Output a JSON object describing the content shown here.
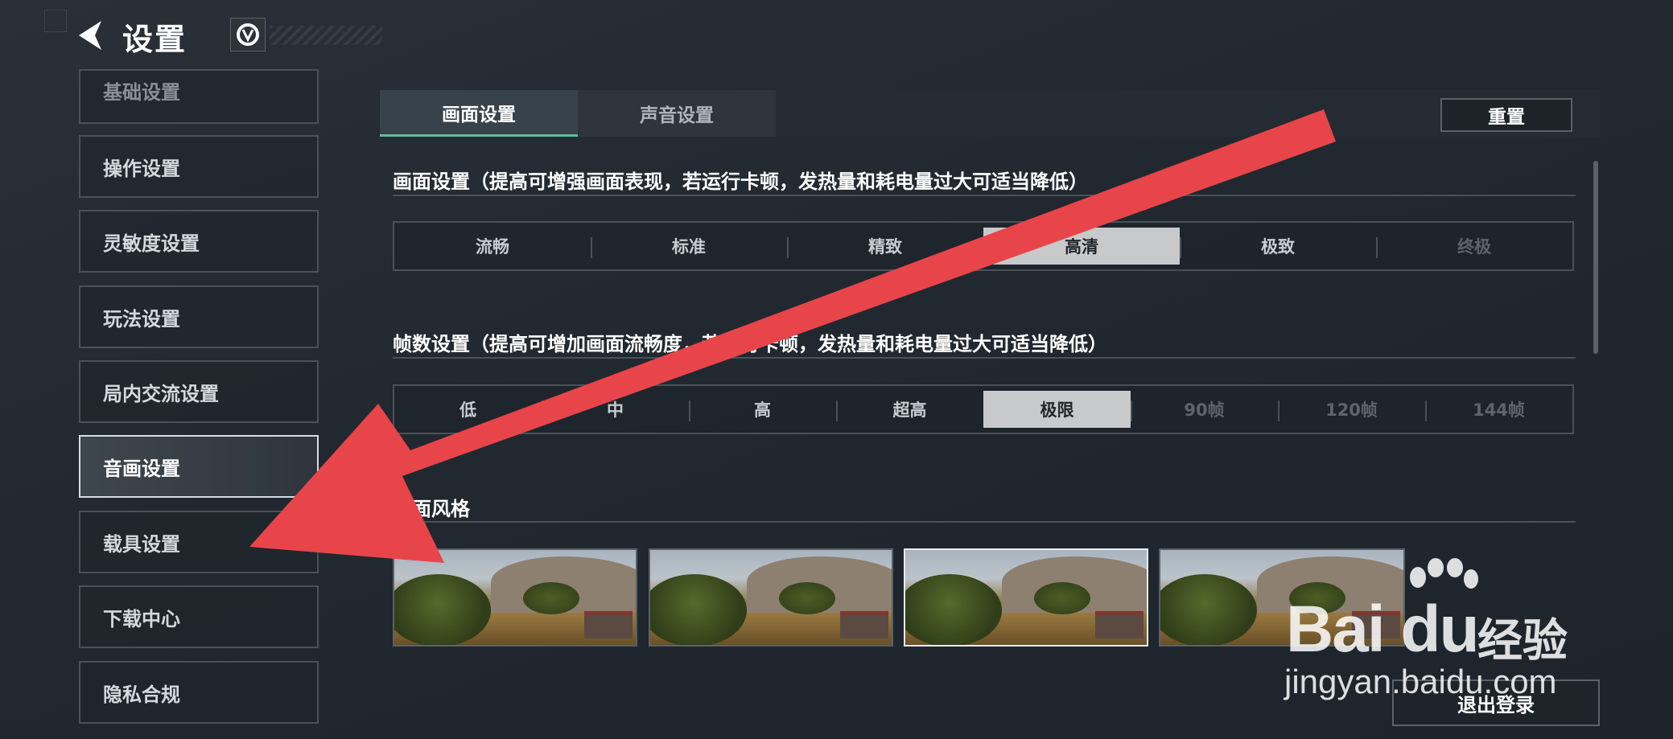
{
  "header": {
    "title": "设置"
  },
  "sidebar": {
    "items": [
      {
        "label": "基础设置"
      },
      {
        "label": "操作设置"
      },
      {
        "label": "灵敏度设置"
      },
      {
        "label": "玩法设置"
      },
      {
        "label": "局内交流设置"
      },
      {
        "label": "音画设置",
        "active": true
      },
      {
        "label": "载具设置"
      },
      {
        "label": "下载中心"
      },
      {
        "label": "隐私合规"
      }
    ]
  },
  "tabs": [
    {
      "label": "画面设置",
      "active": true
    },
    {
      "label": "声音设置"
    }
  ],
  "reset_label": "重置",
  "graphics": {
    "title": "画面设置（提高可增强画面表现，若运行卡顿，发热量和耗电量过大可适当降低）",
    "options": [
      "流畅",
      "标准",
      "精致",
      "高清",
      "极致",
      "终极"
    ],
    "selected": "高清"
  },
  "framerate": {
    "title": "帧数设置（提高可增加画面流畅度，若运行卡顿，发热量和耗电量过大可适当降低）",
    "options": [
      "低",
      "中",
      "高",
      "超高",
      "极限",
      "90帧",
      "120帧",
      "144帧"
    ],
    "selected": "极限"
  },
  "style": {
    "title": "画面风格"
  },
  "logout_label": "退出登录",
  "watermark": {
    "brand": "Bai  du",
    "jingyan": "经验",
    "url": "jingyan.baidu.com"
  },
  "colors": {
    "accent": "#5fbf9a",
    "arrow": "#e8454a"
  }
}
